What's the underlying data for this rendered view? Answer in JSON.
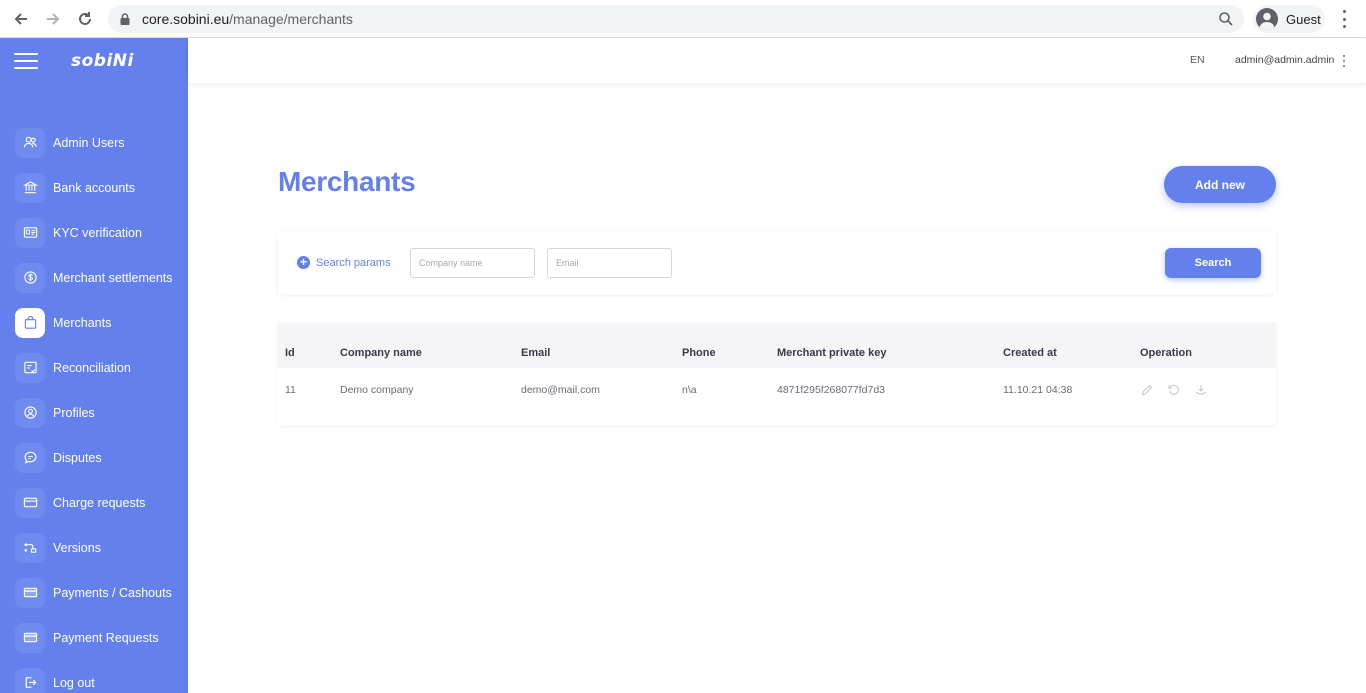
{
  "browser": {
    "url_host": "core.sobini.eu",
    "url_path": "/manage/merchants",
    "profile_label": "Guest"
  },
  "sidebar": {
    "logo": "sobiNi",
    "items": [
      {
        "label": "Admin Users",
        "icon": "users-icon",
        "active": false
      },
      {
        "label": "Bank accounts",
        "icon": "bank-icon",
        "active": false
      },
      {
        "label": "KYC verification",
        "icon": "id-card-icon",
        "active": false
      },
      {
        "label": "Merchant settlements",
        "icon": "dollar-icon",
        "active": false
      },
      {
        "label": "Merchants",
        "icon": "shopping-bag-icon",
        "active": true
      },
      {
        "label": "Reconciliation",
        "icon": "reconcile-icon",
        "active": false
      },
      {
        "label": "Profiles",
        "icon": "profile-icon",
        "active": false
      },
      {
        "label": "Disputes",
        "icon": "chat-icon",
        "active": false
      },
      {
        "label": "Charge requests",
        "icon": "card-icon",
        "active": false
      },
      {
        "label": "Versions",
        "icon": "versions-icon",
        "active": false
      },
      {
        "label": "Payments / Cashouts",
        "icon": "wallet-icon",
        "active": false
      },
      {
        "label": "Payment Requests",
        "icon": "card-icon",
        "active": false
      },
      {
        "label": "Log out",
        "icon": "logout-icon",
        "active": false
      }
    ]
  },
  "header": {
    "language": "EN",
    "user": "admin@admin.admin"
  },
  "main": {
    "title": "Merchants",
    "add_new_label": "Add new",
    "filters": {
      "search_params_label": "Search params",
      "company_placeholder": "Company name",
      "email_placeholder": "Email",
      "search_label": "Search"
    },
    "table": {
      "columns": [
        "Id",
        "Company name",
        "Email",
        "Phone",
        "Merchant private key",
        "Created at",
        "Operation"
      ],
      "rows": [
        [
          "11",
          "Demo company",
          "demo@mail.com",
          "n\\a",
          "4871f295f268077fd7d3",
          "11.10.21 04:38"
        ]
      ]
    }
  },
  "colors": {
    "accent": "#6380ec",
    "sidebar_bg": "#6380ec"
  }
}
